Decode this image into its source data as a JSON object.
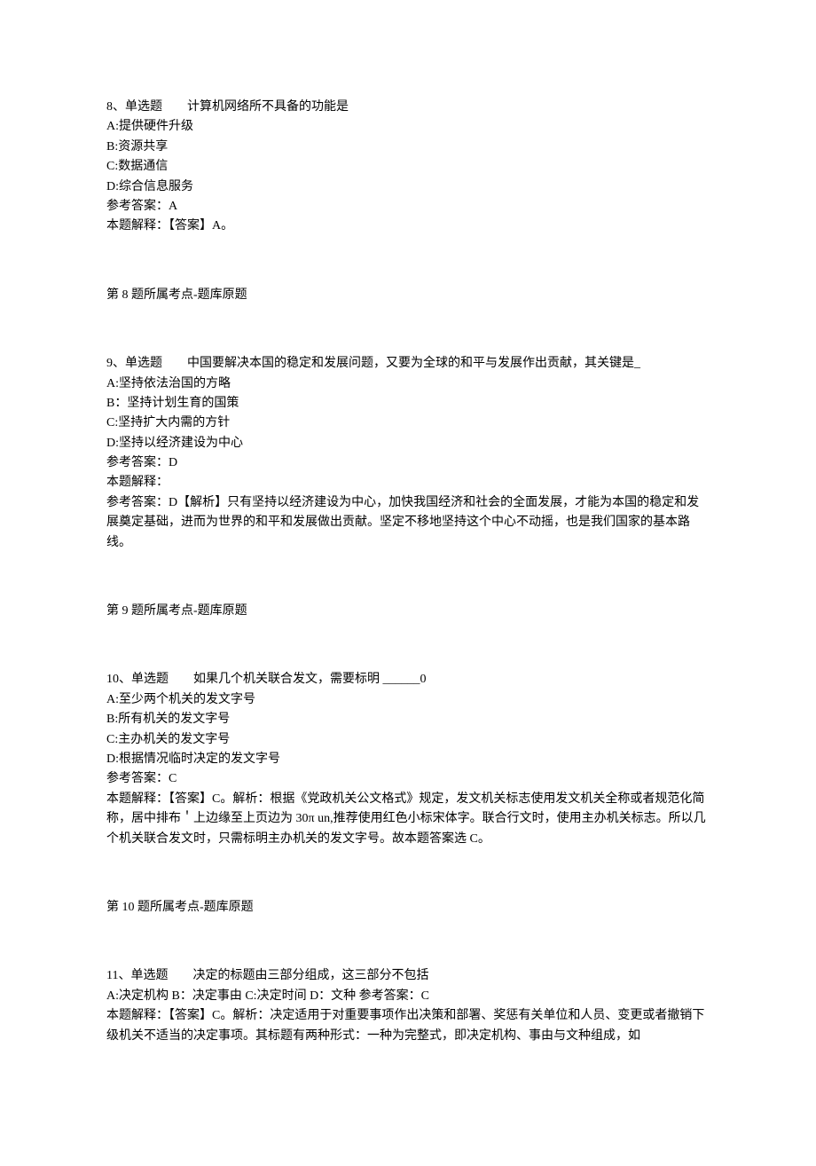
{
  "questions": [
    {
      "header": "8、单选题　　计算机网络所不具备的功能是",
      "options": [
        "A:提供硬件升级",
        "B:资源共享",
        "C:数据通信",
        "D:综合信息服务"
      ],
      "answer_label": "参考答案：A",
      "explain_lines": [
        "本题解释：【答案】A。"
      ],
      "topic_ref": "第 8 题所属考点-题库原题"
    },
    {
      "header": "9、单选题　　中国要解决本国的稳定和发展问题，又要为全球的和平与发展作出贡献，其关键是_",
      "options": [
        "A:坚持依法治国的方略",
        "B：坚持计划生育的国策",
        "C:坚持扩大内需的方针",
        "D:坚持以经济建设为中心"
      ],
      "answer_label": "参考答案：D",
      "explain_lines": [
        "本题解释：",
        "参考答案：D【解析】只有坚持以经济建设为中心，加快我国经济和社会的全面发展，才能为本国的稳定和发展奠定基础，进而为世界的和平和发展做出贡献。坚定不移地坚持这个中心不动摇，也是我们国家的基本路线。"
      ],
      "topic_ref": "第 9 题所属考点-题库原题"
    },
    {
      "header": "10、单选题　　如果几个机关联合发文，需要标明 ______0",
      "options": [
        "A:至少两个机关的发文字号",
        "B:所有机关的发文字号",
        "C:主办机关的发文字号",
        "D:根据情况临时决定的发文字号"
      ],
      "answer_label": "参考答案：C",
      "explain_lines": [
        "本题解释：【答案】C。解析：根据《党政机关公文格式》规定，发文机关标志使用发文机关全称或者规范化简称，居中排布＇上边缘至上页边为 30π un,推荐使用红色小标宋体字。联合行文时，使用主办机关标志。所以几个机关联合发文时，只需标明主办机关的发文字号。故本题答案选 C。"
      ],
      "topic_ref": "第 10 题所属考点-题库原题"
    },
    {
      "header": "11、单选题　　决定的标题由三部分组成，这三部分不包括",
      "options": [
        "A:决定机构 B：决定事由 C:决定时间 D：文种 参考答案：C"
      ],
      "answer_label": "",
      "explain_lines": [
        "本题解释：【答案】C。解析：决定适用于对重要事项作出决策和部署、奖惩有关单位和人员、变更或者撤销下级机关不适当的决定事项。其标题有两种形式：一种为完整式，即决定机构、事由与文种组成，如"
      ],
      "topic_ref": ""
    }
  ]
}
